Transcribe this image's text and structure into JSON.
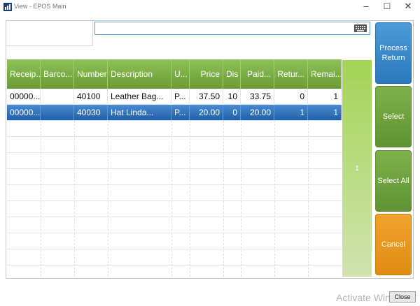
{
  "window": {
    "title": "View - EPOS Main",
    "min_glyph": "–",
    "max_glyph": "☐",
    "close_glyph": "✕"
  },
  "search": {
    "value": "",
    "placeholder": ""
  },
  "table": {
    "columns": [
      "Receip...",
      "Barco...",
      "Number",
      "Description",
      "U...",
      "Price",
      "Dis",
      "Paid...",
      "Retur...",
      "Remai..."
    ],
    "rows": [
      [
        "00000...",
        "",
        "40100",
        "Leather Bag...",
        "P...",
        "37.50",
        "10",
        "33.75",
        "0",
        "1"
      ],
      [
        "00000...",
        "",
        "40030",
        "Hat Linda...",
        "P...",
        "20.00",
        "0",
        "20.00",
        "1",
        "1"
      ]
    ],
    "selected_row": 1
  },
  "pager": {
    "page": "1"
  },
  "actions": {
    "process_return_line1": "Process",
    "process_return_line2": "Return",
    "select": "Select",
    "select_all": "Select All",
    "cancel": "Cancel"
  },
  "footer": {
    "watermark": "Activate Windows",
    "close_label": "Close"
  },
  "colors": {
    "header_green": "#7aad45",
    "selected_blue": "#2f74bf",
    "process_blue": "#3a89cb",
    "cancel_orange": "#e8981f"
  }
}
